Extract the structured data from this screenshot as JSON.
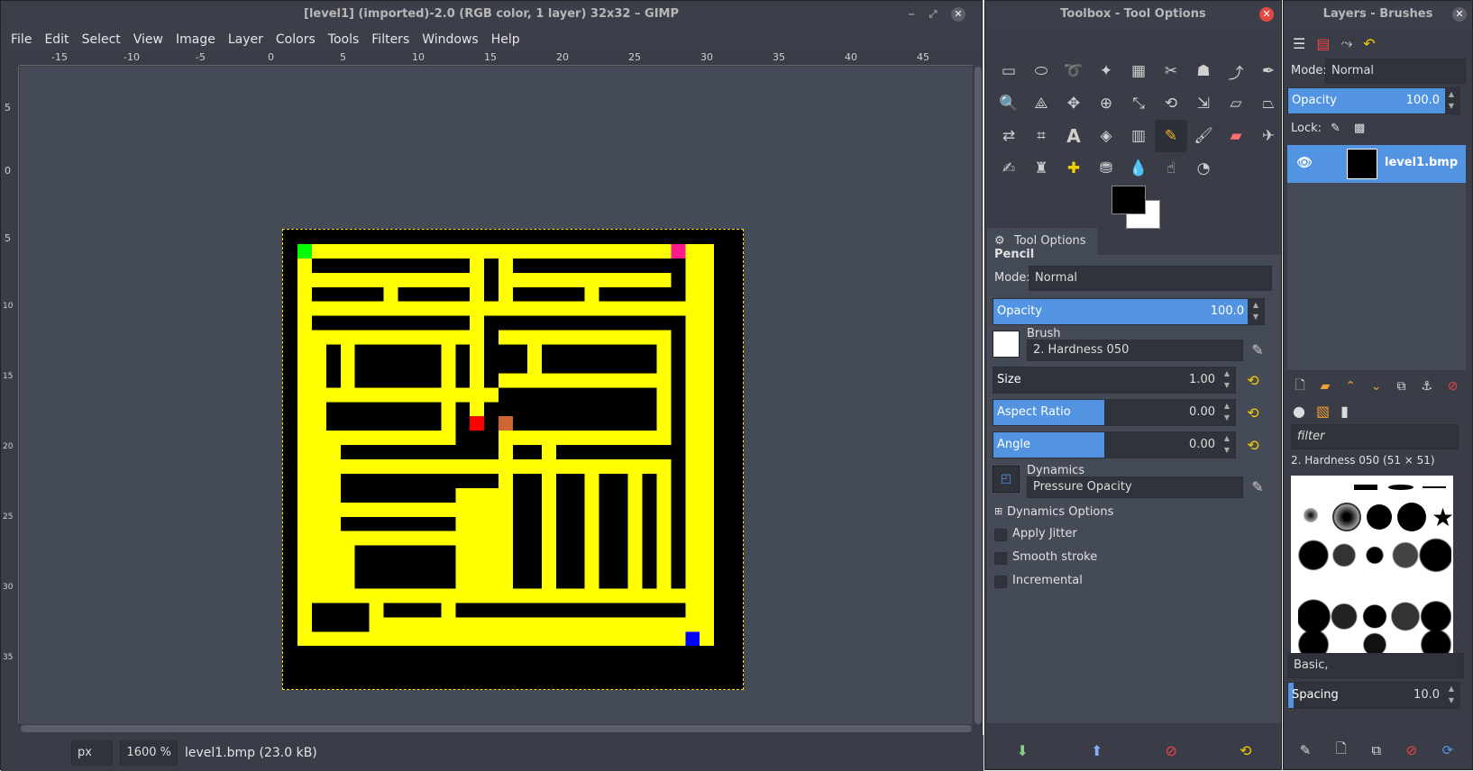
{
  "main": {
    "title": "[level1] (imported)-2.0 (RGB color, 1 layer) 32x32 – GIMP",
    "menus": [
      "File",
      "Edit",
      "Select",
      "View",
      "Image",
      "Layer",
      "Colors",
      "Tools",
      "Filters",
      "Windows",
      "Help"
    ],
    "ruler_h": [
      "-15",
      "-10",
      "-5",
      "0",
      "5",
      "10",
      "15",
      "20",
      "25",
      "30",
      "35",
      "40",
      "45"
    ],
    "ruler_v": [
      "5",
      "0",
      "5",
      "10",
      "15",
      "20",
      "25",
      "30",
      "35"
    ],
    "status": {
      "unit": "px",
      "zoom": "1600 %",
      "file": "level1.bmp (23.0 kB)"
    }
  },
  "toolbox": {
    "title": "Toolbox - Tool Options",
    "tools": [
      "rect-select",
      "ellipse-select",
      "free-select",
      "fuzzy-select",
      "color-select",
      "scissors",
      "foreground-select",
      "paths",
      "color-picker",
      "zoom",
      "measure",
      "move",
      "align",
      "transform",
      "rotate",
      "scale",
      "shear",
      "perspective",
      "flip",
      "cage",
      "text",
      "bucket-fill",
      "blend",
      "pencil",
      "paintbrush",
      "eraser",
      "airbrush",
      "ink",
      "clone",
      "heal",
      "perspective-clone",
      "blur",
      "smudge",
      "dodge"
    ],
    "options_tab": "Tool Options",
    "tool_name": "Pencil",
    "mode_label": "Mode:",
    "mode_value": "Normal",
    "opacity": {
      "label": "Opacity",
      "value": "100.0"
    },
    "brush_label": "Brush",
    "brush_value": "2. Hardness 050",
    "size": {
      "label": "Size",
      "value": "1.00"
    },
    "aspect": {
      "label": "Aspect Ratio",
      "value": "0.00"
    },
    "angle": {
      "label": "Angle",
      "value": "0.00"
    },
    "dynamics_label": "Dynamics",
    "dynamics_value": "Pressure Opacity",
    "dynamics_options": "Dynamics Options",
    "apply_jitter": "Apply Jitter",
    "smooth_stroke": "Smooth stroke",
    "incremental": "Incremental"
  },
  "layers": {
    "title": "Layers - Brushes",
    "mode_label": "Mode:",
    "mode_value": "Normal",
    "opacity_label": "Opacity",
    "opacity_value": "100.0",
    "lock_label": "Lock:",
    "layer_name": "level1.bmp",
    "filter_placeholder": "filter",
    "brush_info": "2. Hardness 050 (51 × 51)",
    "brush_set": "Basic,",
    "spacing_label": "Spacing",
    "spacing_value": "10.0"
  },
  "colors": {
    "accent": "#5294e2",
    "maze": "#ffff00",
    "bg": "#000000"
  }
}
